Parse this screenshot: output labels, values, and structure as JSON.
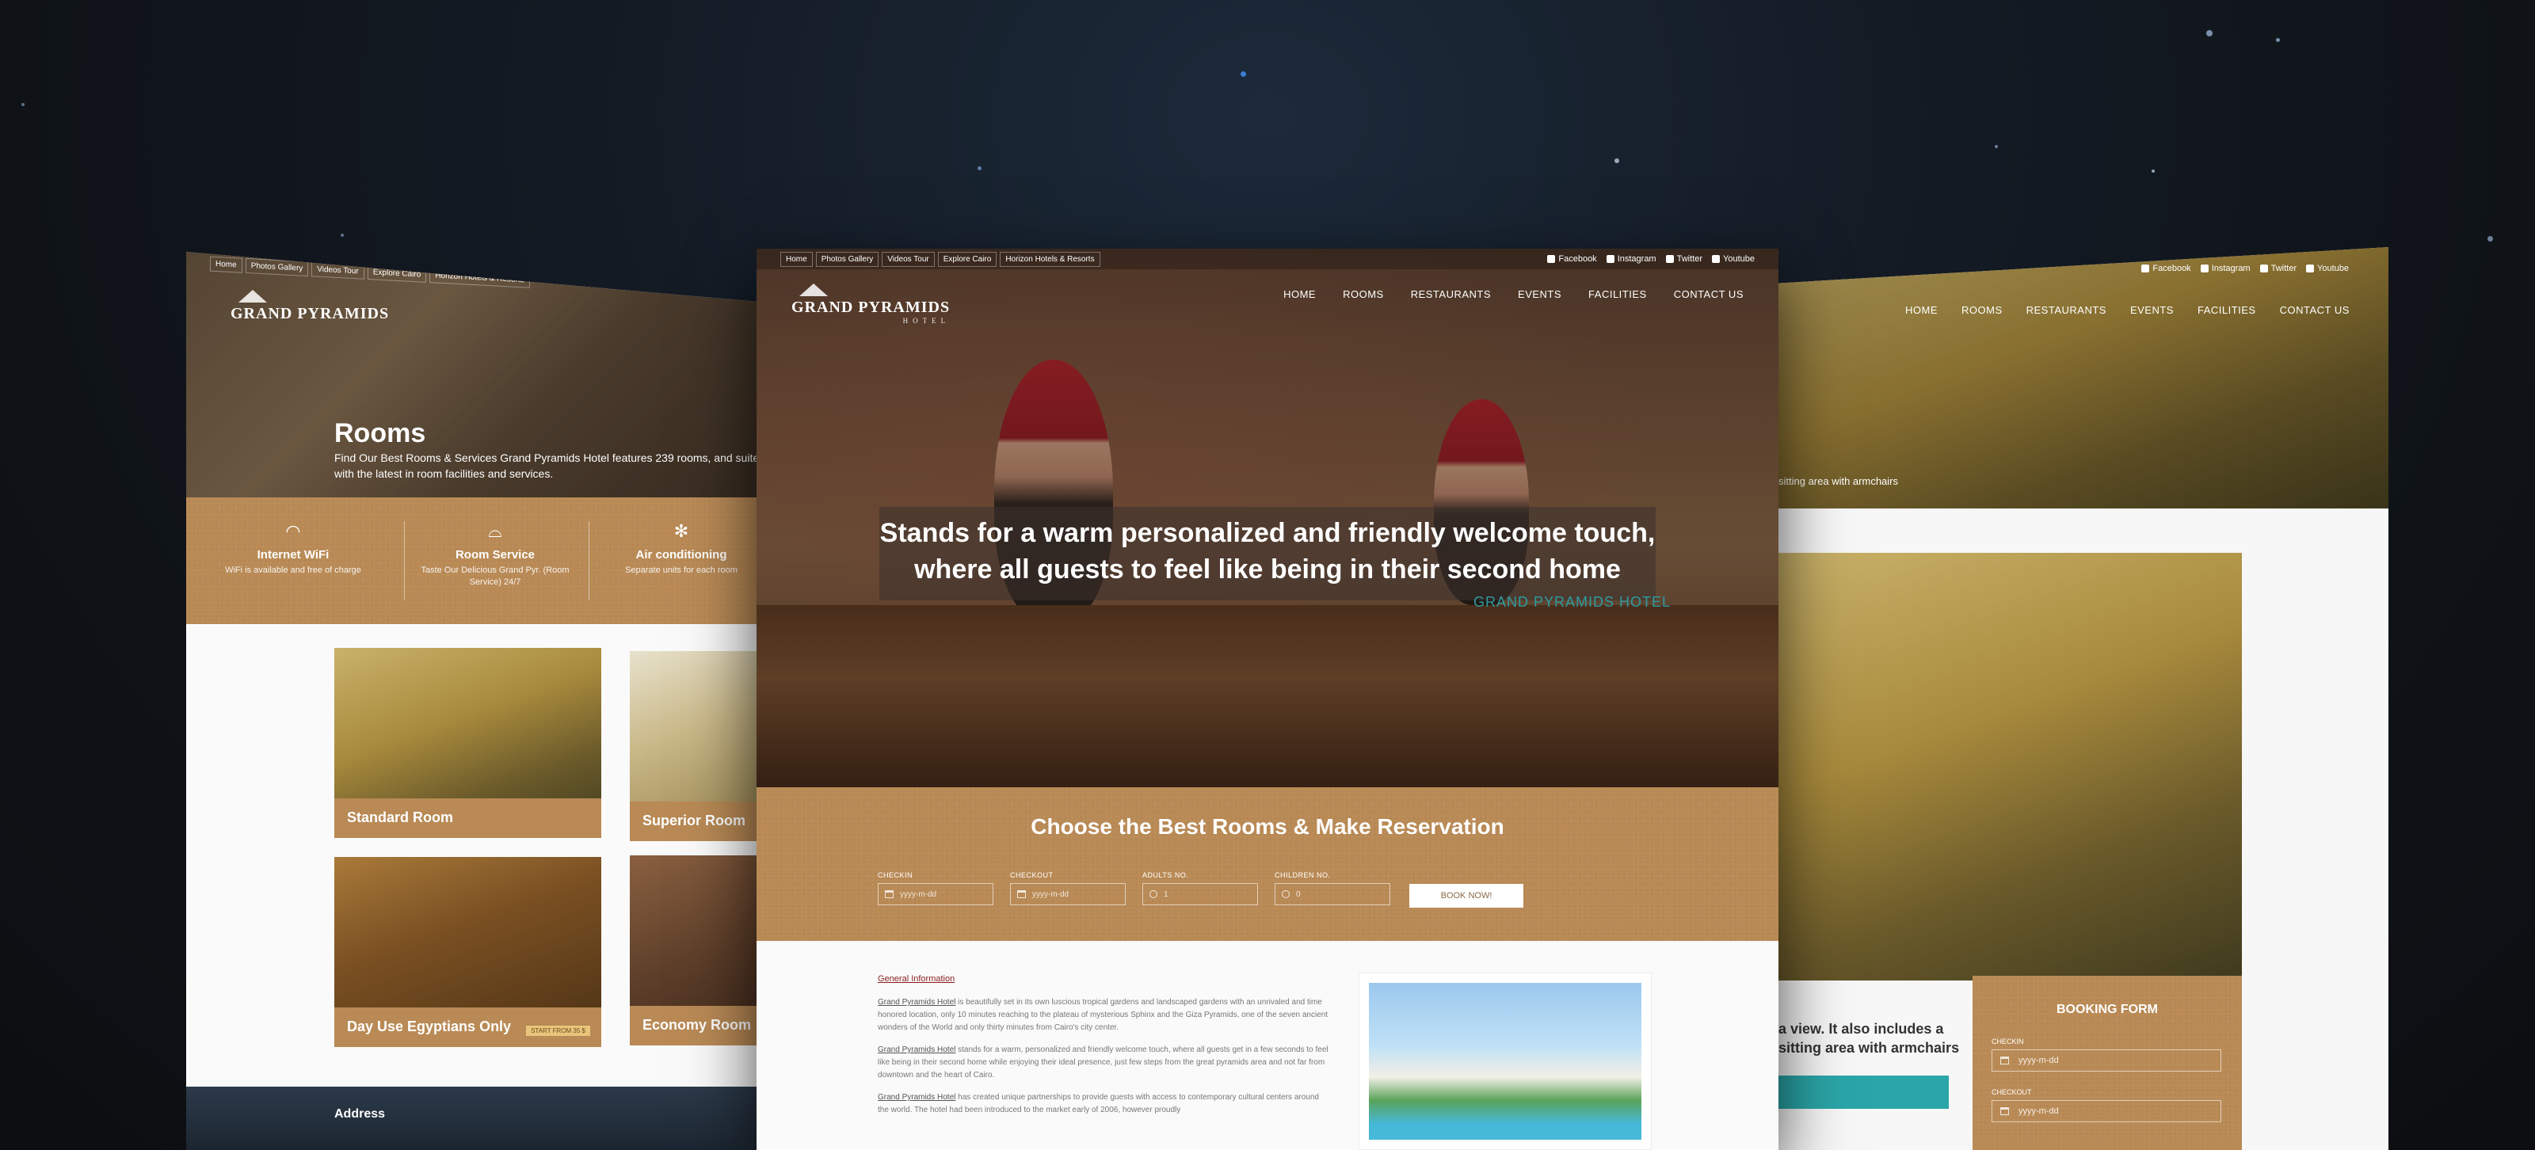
{
  "top_links": [
    "Home",
    "Photos Gallery",
    "Videos Tour",
    "Explore Cairo",
    "Horizon Hotels & Resorts"
  ],
  "social": [
    "Facebook",
    "Instagram",
    "Twitter",
    "Youtube"
  ],
  "logo": {
    "name": "Grand Pyramids",
    "sub": "HOTEL"
  },
  "nav": [
    "HOME",
    "ROOMS",
    "RESTAURANTS",
    "EVENTS",
    "FACILITIES",
    "CONTACT US"
  ],
  "hero": {
    "line1": "Stands for a warm personalized and friendly welcome touch,",
    "line2": "where all guests to feel like being in their second home",
    "sub": "GRAND PYRAMIDS HOTEL"
  },
  "reservation": {
    "title": "Choose the Best Rooms & Make Reservation",
    "fields": [
      {
        "label": "CHECKIN",
        "placeholder": "yyyy-m-dd"
      },
      {
        "label": "CHECKOUT",
        "placeholder": "yyyy-m-dd"
      },
      {
        "label": "ADULTS NO.",
        "placeholder": "1"
      },
      {
        "label": "CHILDREN NO.",
        "placeholder": "0"
      }
    ],
    "button": "BOOK NOW!"
  },
  "info": {
    "heading": "General Information",
    "p1_link": "Grand Pyramids Hotel",
    "p1": " is beautifully set in its own luscious tropical gardens and landscaped gardens with an unrivaled and time honored location, only 10 minutes reaching to the plateau of mysterious Sphinx and the Giza Pyramids, one of the seven ancient wonders of the World and only thirty minutes from Cairo's city center.",
    "p2_link": "Grand Pyramids Hotel",
    "p2": " stands for a warm, personalized and friendly welcome touch, where all guests get in a few seconds to feel like being in their second home while enjoying their ideal presence, just few steps from the great pyramids area and not far from downtown and the heart of Cairo.",
    "p3_link": "Grand Pyramids Hotel",
    "p3": " has created unique partnerships to provide guests with access to contemporary cultural centers around the world. The hotel had been introduced to the market early of 2006, however proudly"
  },
  "left": {
    "title": "Rooms",
    "desc": "Find Our Best Rooms & Services Grand Pyramids Hotel features 239 rooms, and suites with the latest in room facilities and services.",
    "features": [
      {
        "icon": "wifi-icon",
        "title": "Internet WiFi",
        "desc": "WiFi is available and free of charge"
      },
      {
        "icon": "room-service-icon",
        "title": "Room Service",
        "desc": "Taste Our Delicious Grand Pyr. (Room Service) 24/7"
      },
      {
        "icon": "snowflake-icon",
        "title": "Air conditioning",
        "desc": "Separate units for each room"
      }
    ],
    "rooms": [
      "Standard Room",
      "Superior Room",
      "Day Use Egyptians Only",
      "Economy Room"
    ],
    "ribbon": "START FROM 35 $",
    "footer": "Address"
  },
  "right": {
    "caption": "sitting area with armchairs",
    "desc": "a view. It also includes a sitting area with armchairs",
    "form_title": "BOOKING FORM",
    "fields": [
      {
        "label": "CHECKIN",
        "placeholder": "yyyy-m-dd"
      },
      {
        "label": "CHECKOUT",
        "placeholder": "yyyy-m-dd"
      }
    ]
  }
}
